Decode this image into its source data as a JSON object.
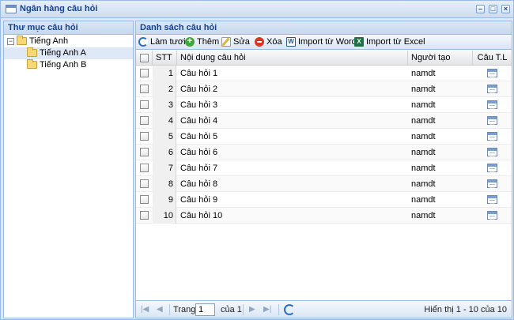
{
  "window": {
    "title": "Ngân hàng câu hỏi",
    "buttons": [
      "–",
      "□",
      "×"
    ]
  },
  "left_panel": {
    "title": "Thư mục câu hỏi",
    "tree": {
      "root": "Tiếng Anh",
      "toggle": "−",
      "children": [
        "Tiếng Anh A",
        "Tiếng Anh B"
      ]
    }
  },
  "right_panel": {
    "title": "Danh sách câu hỏi",
    "toolbar": {
      "refresh": "Làm tươi",
      "add": "Thêm",
      "edit": "Sửa",
      "delete": "Xóa",
      "import_word": "Import từ Word",
      "import_excel": "Import từ Excel"
    },
    "columns": {
      "stt": "STT",
      "content": "Nội dung câu hỏi",
      "creator": "Người tạo",
      "answers": "Câu T.L"
    },
    "rows": [
      {
        "stt": "1",
        "content": "Câu hỏi 1",
        "creator": "namdt"
      },
      {
        "stt": "2",
        "content": "Câu hỏi 2",
        "creator": "namdt"
      },
      {
        "stt": "3",
        "content": "Câu hỏi 3",
        "creator": "namdt"
      },
      {
        "stt": "4",
        "content": "Câu hỏi 4",
        "creator": "namdt"
      },
      {
        "stt": "5",
        "content": "Câu hỏi 5",
        "creator": "namdt"
      },
      {
        "stt": "6",
        "content": "Câu hỏi 6",
        "creator": "namdt"
      },
      {
        "stt": "7",
        "content": "Câu hỏi 7",
        "creator": "namdt"
      },
      {
        "stt": "8",
        "content": "Câu hỏi 8",
        "creator": "namdt"
      },
      {
        "stt": "9",
        "content": "Câu hỏi 9",
        "creator": "namdt"
      },
      {
        "stt": "10",
        "content": "Câu hỏi 10",
        "creator": "namdt"
      }
    ],
    "pager": {
      "first": "|◀",
      "prev": "◀",
      "next": "▶",
      "last": "▶|",
      "page_label": "Trang",
      "page_value": "1",
      "of_label": "của 1",
      "summary": "Hiển thị 1 - 10 của 10"
    }
  },
  "colors": {
    "accent": "#15428b",
    "border": "#99bbe8",
    "add": "#3fa63a",
    "delete": "#d9352b",
    "word": "#2b5797",
    "excel": "#1f7244"
  }
}
